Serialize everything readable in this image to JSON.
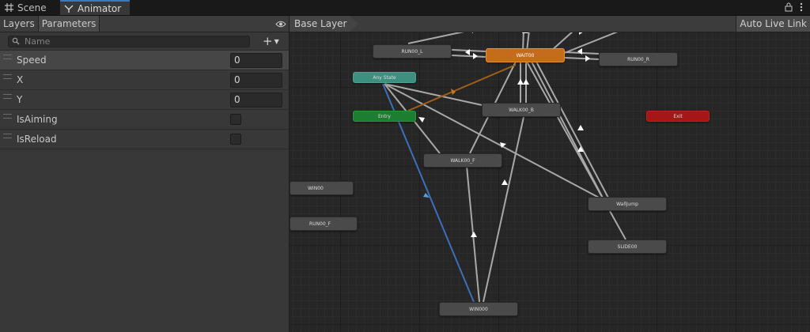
{
  "tabs": {
    "scene": "Scene",
    "animator": "Animator"
  },
  "left_panel": {
    "tabs": {
      "layers": "Layers",
      "parameters": "Parameters"
    },
    "search_placeholder": "Name",
    "parameters": [
      {
        "name": "Speed",
        "type": "float",
        "value": "0"
      },
      {
        "name": "X",
        "type": "float",
        "value": "0"
      },
      {
        "name": "Y",
        "type": "float",
        "value": "0"
      },
      {
        "name": "IsAiming",
        "type": "bool",
        "checked": false
      },
      {
        "name": "IsReload",
        "type": "bool",
        "checked": false
      }
    ]
  },
  "graph": {
    "breadcrumb": "Base Layer",
    "auto_live_link": "Auto Live Link",
    "nodes": {
      "run00_l": "RUN00_L",
      "wait00": "WAIT00",
      "run00_r": "RUN00_R",
      "any_state": "Any State",
      "entry": "Entry",
      "walk00_b": "WALK00_B",
      "exit": "Exit",
      "walk00_f": "WALK00_F",
      "win00": "WIN00",
      "run00_f": "RUN00_F",
      "walljump": "WallJump",
      "slide00": "SLIDE00",
      "winooo": "WIN000"
    }
  },
  "colors": {
    "default_state": "#4a4a4a",
    "default_layer_state": "#c46b1c",
    "any_state": "#3d8f7f",
    "entry": "#1d7d30",
    "exit": "#a71616",
    "selected_transition": "#3a6fbb"
  }
}
